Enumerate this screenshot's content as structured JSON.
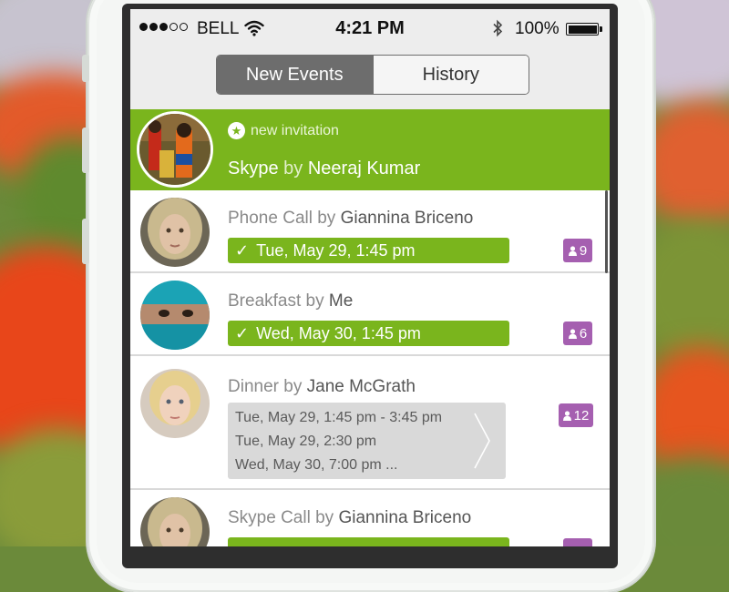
{
  "status_bar": {
    "signal_dots": [
      "on",
      "on",
      "on",
      "off",
      "off"
    ],
    "carrier": "BELL",
    "time": "4:21 PM",
    "battery_percent": "100%",
    "battery_level": 1.0
  },
  "segments": {
    "active": "New Events",
    "inactive": "History"
  },
  "invitation": {
    "label": "new invitation",
    "event": "Skype",
    "by": "by",
    "organizer": "Neeraj Kumar"
  },
  "events": [
    {
      "event": "Phone Call",
      "by": "by",
      "organizer": "Giannina Briceno",
      "confirmed_time": "Tue, May 29, 1:45 pm",
      "attendees": "9"
    },
    {
      "event": "Breakfast",
      "by": "by",
      "organizer": "Me",
      "confirmed_time": "Wed, May 30, 1:45 pm",
      "attendees": "6"
    },
    {
      "event": "Dinner",
      "by": "by",
      "organizer": "Jane McGrath",
      "attendees": "12",
      "proposed_times": [
        "Tue, May 29, 1:45 pm - 3:45 pm",
        "Tue, May 29, 2:30 pm",
        "Wed, May 30, 7:00 pm ..."
      ]
    },
    {
      "event": "Skype Call",
      "by": "by",
      "organizer": "Giannina Briceno"
    }
  ],
  "icons": {
    "wifi": "wifi-icon",
    "bluetooth": "bluetooth-icon",
    "battery": "battery-icon",
    "star": "star-icon",
    "check": "check-icon",
    "person": "person-icon",
    "chevron": "chevron-right-icon"
  },
  "colors": {
    "accent_green": "#7ab51d",
    "badge_purple": "#a55fb0",
    "segment_gray": "#6d6d6d"
  }
}
